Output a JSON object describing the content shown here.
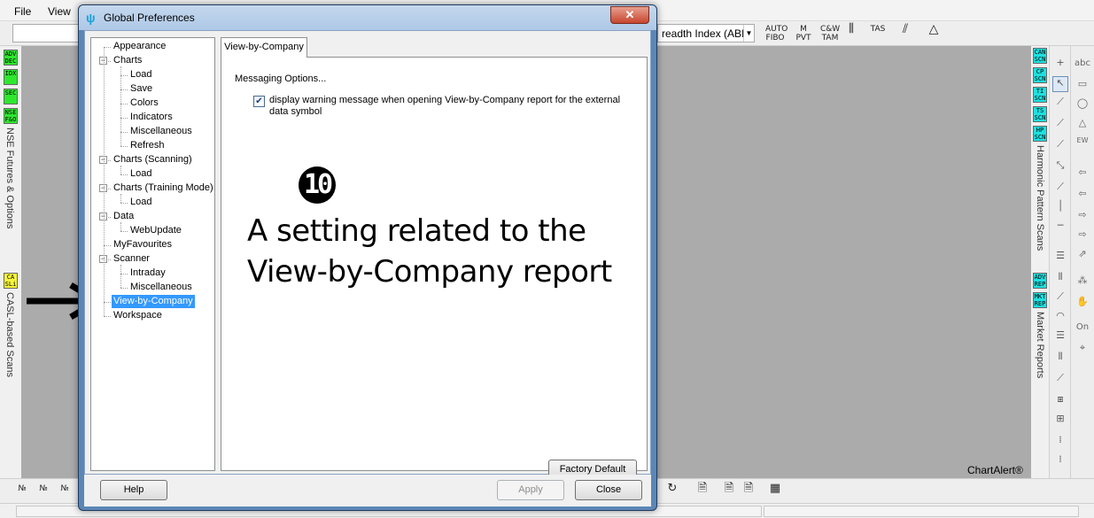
{
  "menu": {
    "file": "File",
    "view": "View"
  },
  "toolbar": {
    "breadth_label": "readth Index (ABI",
    "icons": [
      "AUTO FIBO",
      "M PVT",
      "C&W TAM",
      "TAS"
    ]
  },
  "left_strip": {
    "tags": [
      "ADV DEC",
      "IDX",
      "SEC",
      "NSE F&O",
      "CA SLi"
    ],
    "labels": [
      "NSE Futures & Options",
      "CASL-based Scans"
    ]
  },
  "right_strip": {
    "tags": [
      "CAN SCN",
      "CP SCN",
      "TI SCN",
      "TS SCN",
      "HP SCN",
      "ADV REP",
      "MKT REP"
    ],
    "labels": [
      "Harmonic Pattern Scans",
      "Market Reports"
    ],
    "on_label": "On",
    "abc_label": "abc"
  },
  "brand": "ChartAlert®",
  "annotation": {
    "number": "10",
    "text": "A setting related to the View-by-Company report"
  },
  "dialog": {
    "title": "Global Preferences",
    "close_glyph": "✕",
    "tree": [
      {
        "label": "Appearance",
        "level": 0
      },
      {
        "label": "Charts",
        "level": 0,
        "expanded": true
      },
      {
        "label": "Load",
        "level": 1
      },
      {
        "label": "Save",
        "level": 1
      },
      {
        "label": "Colors",
        "level": 1
      },
      {
        "label": "Indicators",
        "level": 1
      },
      {
        "label": "Miscellaneous",
        "level": 1
      },
      {
        "label": "Refresh",
        "level": 1
      },
      {
        "label": "Charts (Scanning)",
        "level": 0,
        "expanded": true
      },
      {
        "label": "Load",
        "level": 1
      },
      {
        "label": "Charts (Training Mode)",
        "level": 0,
        "expanded": true
      },
      {
        "label": "Load",
        "level": 1
      },
      {
        "label": "Data",
        "level": 0,
        "expanded": true
      },
      {
        "label": "WebUpdate",
        "level": 1
      },
      {
        "label": "MyFavourites",
        "level": 0
      },
      {
        "label": "Scanner",
        "level": 0,
        "expanded": true
      },
      {
        "label": "Intraday",
        "level": 1
      },
      {
        "label": "Miscellaneous",
        "level": 1
      },
      {
        "label": "View-by-Company",
        "level": 0,
        "selected": true
      },
      {
        "label": "Workspace",
        "level": 0
      }
    ],
    "tab_label": "View-by-Company",
    "section_label": "Messaging Options...",
    "option": {
      "checked": true,
      "label": "display warning message when opening View-by-Company report for the external data symbol"
    },
    "factory_default_label": "Factory Default",
    "help_label": "Help",
    "apply_label": "Apply",
    "close_label": "Close"
  }
}
